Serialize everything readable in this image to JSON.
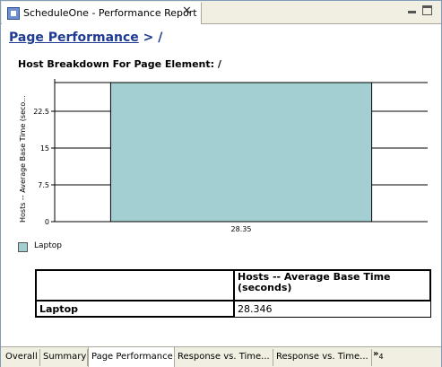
{
  "window": {
    "title": "ScheduleOne - Performance Report"
  },
  "page": {
    "title_link": "Page Performance",
    "title_suffix": " > /"
  },
  "chart_data": {
    "type": "bar",
    "title": "Host Breakdown For Page Element: /",
    "ylabel": "Hosts -- Average Base Time (seco...",
    "xlabel": "",
    "categories": [
      "28.35"
    ],
    "series": [
      {
        "name": "Laptop",
        "values": [
          28.346
        ],
        "color": "#a4cfd2"
      }
    ],
    "yticks": [
      "0",
      "7.5",
      "15",
      "22.5"
    ],
    "ylim": [
      0,
      28.35
    ],
    "grid": true,
    "legend_position": "bottom-left"
  },
  "legend": {
    "items": [
      "Laptop"
    ]
  },
  "table": {
    "header": "Hosts -- Average Base Time (seconds)",
    "rows": [
      {
        "label": "Laptop",
        "value": "28.346"
      }
    ]
  },
  "bottom_tabs": {
    "items": [
      "Overall",
      "Summary",
      "Page Performance",
      "Response vs. Time...",
      "Response vs. Time..."
    ],
    "active": "Page Performance",
    "overflow_label": "»",
    "overflow_count": "4"
  }
}
